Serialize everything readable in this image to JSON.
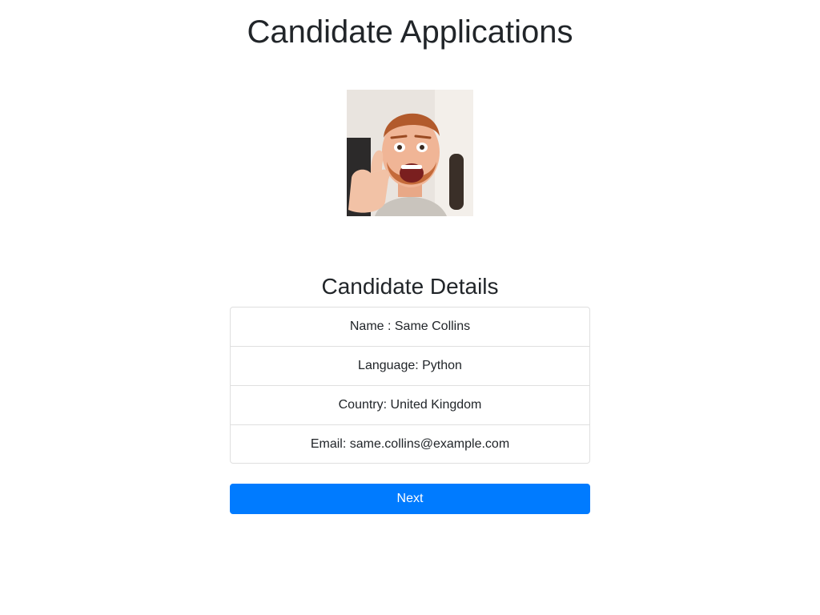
{
  "header": {
    "title": "Candidate Applications"
  },
  "candidate": {
    "photo_icon": "candidate-photo",
    "section_title": "Candidate Details",
    "fields": [
      {
        "label": "Name",
        "separator": " : ",
        "value": "Same Collins",
        "text": "Name : Same Collins"
      },
      {
        "label": "Language",
        "separator": ": ",
        "value": "Python",
        "text": "Language: Python"
      },
      {
        "label": "Country",
        "separator": ": ",
        "value": "United Kingdom",
        "text": "Country: United Kingdom"
      },
      {
        "label": "Email",
        "separator": ": ",
        "value": "same.collins@example.com",
        "text": "Email: same.collins@example.com"
      }
    ]
  },
  "actions": {
    "next_label": "Next"
  },
  "colors": {
    "primary": "#007bff",
    "text": "#212529",
    "border": "rgba(0,0,0,0.125)"
  }
}
